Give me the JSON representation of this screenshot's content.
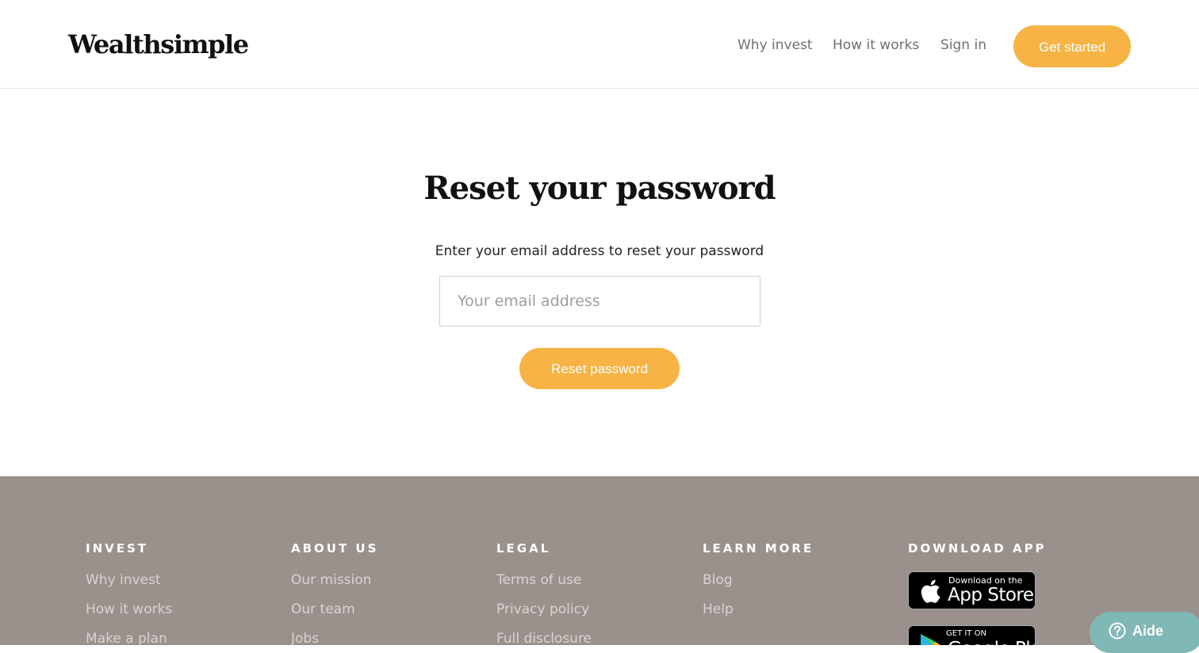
{
  "header": {
    "logo": "Wealthsimple",
    "nav": {
      "why_invest": "Why invest",
      "how_it_works": "How it works",
      "sign_in": "Sign in"
    },
    "cta_label": "Get started"
  },
  "main": {
    "title": "Reset your password",
    "subtitle": "Enter your email address to reset your password",
    "email_placeholder": "Your email address",
    "submit_label": "Reset password"
  },
  "footer": {
    "columns": [
      {
        "heading": "INVEST",
        "links": [
          "Why invest",
          "How it works",
          "Make a plan"
        ]
      },
      {
        "heading": "ABOUT US",
        "links": [
          "Our mission",
          "Our team",
          "Jobs"
        ]
      },
      {
        "heading": "LEGAL",
        "links": [
          "Terms of use",
          "Privacy policy",
          "Full disclosure"
        ]
      },
      {
        "heading": "LEARN MORE",
        "links": [
          "Blog",
          "Help"
        ]
      },
      {
        "heading": "DOWNLOAD APP",
        "links": []
      }
    ],
    "app_store": {
      "small": "Download on the",
      "big": "App Store",
      "icon": "apple-icon"
    },
    "google_play": {
      "small": "GET IT ON",
      "big": "Google Play",
      "icon": "google-play-icon"
    }
  },
  "help_widget": {
    "label": "Aide",
    "icon": "question-circle-icon"
  },
  "colors": {
    "accent": "#f7b344",
    "footer_bg": "#9a918c",
    "help_bg": "#7fb8b5"
  }
}
